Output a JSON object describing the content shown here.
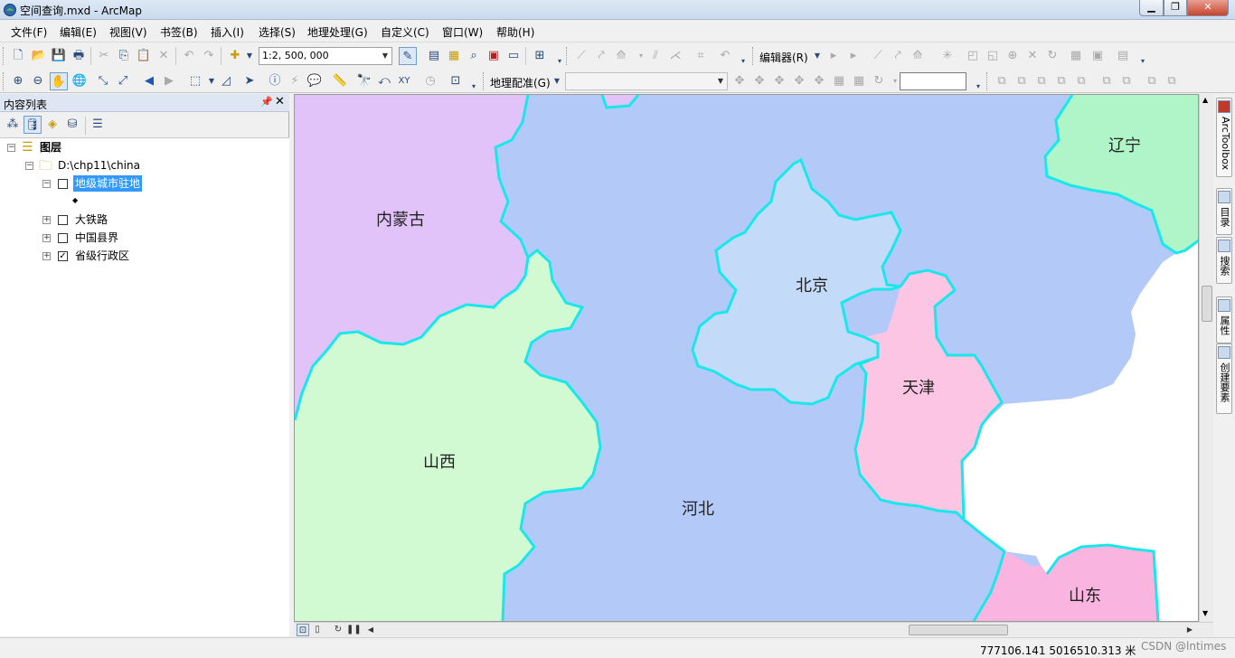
{
  "window": {
    "title": "空间查询.mxd - ArcMap"
  },
  "menu": [
    "文件(F)",
    "编辑(E)",
    "视图(V)",
    "书签(B)",
    "插入(I)",
    "选择(S)",
    "地理处理(G)",
    "自定义(C)",
    "窗口(W)",
    "帮助(H)"
  ],
  "toolbar": {
    "scale_value": "1:2, 500, 000",
    "editor_label": "编辑器(R)",
    "georef_label": "地理配准(G)",
    "georef_layer_value": "",
    "georef_input_value": ""
  },
  "toc": {
    "title": "内容列表",
    "root": "图层",
    "datasource": "D:\\chp11\\china",
    "layers": [
      {
        "name": "地级城市驻地",
        "checked": false,
        "expanded": true,
        "selected": true,
        "symbol": "◆"
      },
      {
        "name": "大铁路",
        "checked": false,
        "expanded": false
      },
      {
        "name": "中国县界",
        "checked": false,
        "expanded": false
      },
      {
        "name": "省级行政区",
        "checked": true,
        "expanded": false
      }
    ]
  },
  "map": {
    "provinces": [
      {
        "name": "内蒙古",
        "color": "#e1c3fa"
      },
      {
        "name": "辽宁",
        "color": "#b0f5c8"
      },
      {
        "name": "北京",
        "color": "#c3dbf9"
      },
      {
        "name": "天津",
        "color": "#fbc5e3"
      },
      {
        "name": "山西",
        "color": "#d2fad2"
      },
      {
        "name": "河北",
        "color": "#b3c9f7"
      },
      {
        "name": "山东",
        "color": "#f9b5e0"
      }
    ],
    "border_color": "#18e8ea"
  },
  "right_dock": [
    "ArcToolbox",
    "目录",
    "搜索",
    "属性",
    "创建要素"
  ],
  "status": {
    "coords": "777106.141  5016510.313 米"
  },
  "watermark": "CSDN @lntimes"
}
